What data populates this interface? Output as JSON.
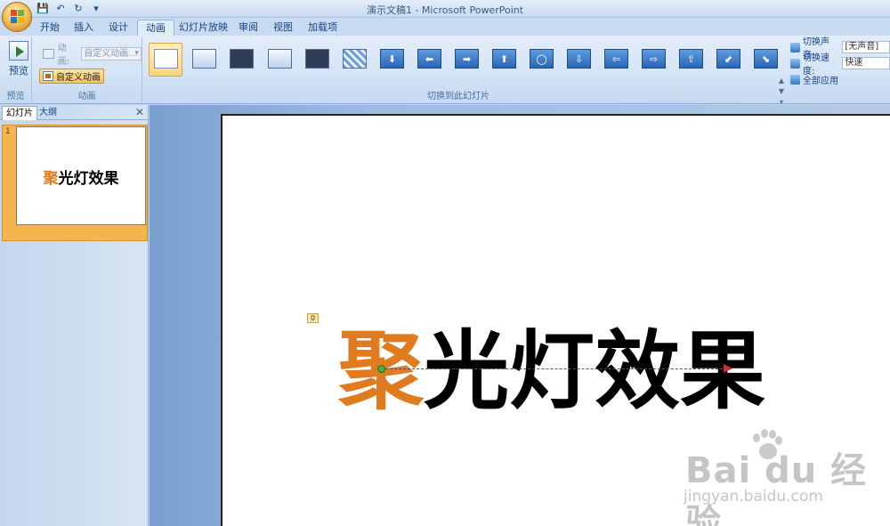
{
  "window": {
    "title": "演示文稿1 - Microsoft PowerPoint"
  },
  "quick_access": {
    "save": "💾",
    "undo": "↶",
    "redo": "↻",
    "customize": "▾"
  },
  "tabs": [
    {
      "label": "开始"
    },
    {
      "label": "插入"
    },
    {
      "label": "设计"
    },
    {
      "label": "动画",
      "active": true
    },
    {
      "label": "幻灯片放映"
    },
    {
      "label": "审阅"
    },
    {
      "label": "视图"
    },
    {
      "label": "加载项"
    }
  ],
  "ribbon": {
    "preview": {
      "label": "预览",
      "group_label": "预览"
    },
    "animation": {
      "group_label": "动画",
      "animate_label": "动画:",
      "animate_value": "自定义动画...",
      "custom_label": "自定义动画"
    },
    "transition": {
      "group_label": "切换到此幻灯片",
      "sound_label": "切换声音:",
      "sound_value": "[无声音]",
      "speed_label": "切换速度:",
      "speed_value": "快速",
      "apply_all_label": "全部应用"
    }
  },
  "left_panel": {
    "tabs": [
      {
        "label": "幻灯片",
        "active": true
      },
      {
        "label": "大纲"
      }
    ],
    "close_icon": "✕",
    "slides": [
      {
        "number": "1",
        "title_first": "聚",
        "title_rest": "光灯效果"
      }
    ]
  },
  "slide": {
    "anim_tag": "0",
    "title_first": "聚",
    "title_rest": "光灯效果",
    "accent_color": "#e07b1f"
  },
  "watermark": {
    "logo": "Bai du 经验",
    "url": "jingyan.baidu.com"
  }
}
